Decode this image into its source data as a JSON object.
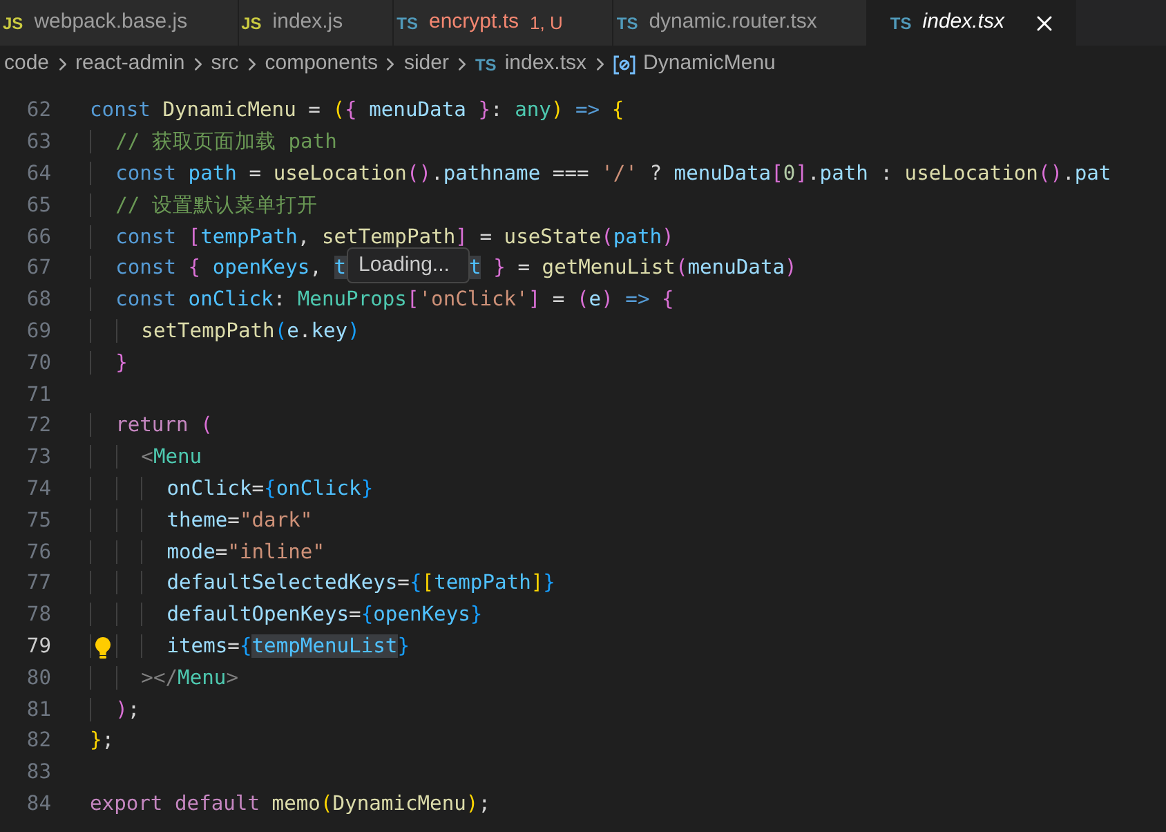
{
  "tabs": [
    {
      "icon": "JS",
      "kind": "js",
      "label": "webpack.base.js",
      "error": false,
      "selected": false
    },
    {
      "icon": "JS",
      "kind": "js",
      "label": "index.js",
      "error": false,
      "selected": false
    },
    {
      "icon": "TS",
      "kind": "ts",
      "label": "encrypt.ts",
      "status": "1, U",
      "error": true,
      "selected": false
    },
    {
      "icon": "TS",
      "kind": "ts",
      "label": "dynamic.router.tsx",
      "error": false,
      "selected": false
    },
    {
      "icon": "TS",
      "kind": "ts",
      "label": "index.tsx",
      "error": false,
      "selected": true
    }
  ],
  "breadcrumb": [
    {
      "label": "code",
      "kind": "folder"
    },
    {
      "label": "react-admin",
      "kind": "folder"
    },
    {
      "label": "src",
      "kind": "folder"
    },
    {
      "label": "components",
      "kind": "folder"
    },
    {
      "label": "sider",
      "kind": "folder"
    },
    {
      "label": "index.tsx",
      "kind": "file",
      "icon": "TS"
    },
    {
      "label": "DynamicMenu",
      "kind": "symbol"
    }
  ],
  "editor": {
    "lines": [
      {
        "number": "62",
        "tokens": [
          {
            "text": "const ",
            "kind": "kw"
          },
          {
            "text": "DynamicMenu",
            "kind": "fn"
          },
          {
            "text": " = ",
            "kind": "p"
          },
          {
            "text": "(",
            "kind": "b1"
          },
          {
            "text": "{",
            "kind": "b2"
          },
          {
            "text": " menuData ",
            "kind": "var"
          },
          {
            "text": "}",
            "kind": "b2"
          },
          {
            "text": ": ",
            "kind": "p"
          },
          {
            "text": "any",
            "kind": "type"
          },
          {
            "text": ") ",
            "kind": "b1"
          },
          {
            "text": "=> ",
            "kind": "kw"
          },
          {
            "text": "{",
            "kind": "b1"
          }
        ]
      },
      {
        "number": "63",
        "tokens": [
          {
            "text": "  // 获取页面加载 path",
            "kind": "cmt"
          }
        ]
      },
      {
        "number": "64",
        "tokens": [
          {
            "text": "  const ",
            "kind": "kw"
          },
          {
            "text": "path",
            "kind": "cst"
          },
          {
            "text": " = ",
            "kind": "p"
          },
          {
            "text": "useLocation",
            "kind": "fn"
          },
          {
            "text": "()",
            "kind": "b2"
          },
          {
            "text": ".",
            "kind": "p"
          },
          {
            "text": "pathname",
            "kind": "var"
          },
          {
            "text": " === ",
            "kind": "p"
          },
          {
            "text": "'/'",
            "kind": "str"
          },
          {
            "text": " ? ",
            "kind": "p"
          },
          {
            "text": "menuData",
            "kind": "var"
          },
          {
            "text": "[",
            "kind": "b2"
          },
          {
            "text": "0",
            "kind": "num"
          },
          {
            "text": "]",
            "kind": "b2"
          },
          {
            "text": ".",
            "kind": "p"
          },
          {
            "text": "path",
            "kind": "var"
          },
          {
            "text": " : ",
            "kind": "p"
          },
          {
            "text": "useLocation",
            "kind": "fn"
          },
          {
            "text": "()",
            "kind": "b2"
          },
          {
            "text": ".",
            "kind": "p"
          },
          {
            "text": "pat",
            "kind": "var"
          }
        ]
      },
      {
        "number": "65",
        "tokens": [
          {
            "text": "  // 设置默认菜单打开",
            "kind": "cmt"
          }
        ]
      },
      {
        "number": "66",
        "tokens": [
          {
            "text": "  const ",
            "kind": "kw"
          },
          {
            "text": "[",
            "kind": "b2"
          },
          {
            "text": "tempPath",
            "kind": "cst"
          },
          {
            "text": ", ",
            "kind": "p"
          },
          {
            "text": "setTempPath",
            "kind": "fn"
          },
          {
            "text": "]",
            "kind": "b2"
          },
          {
            "text": " = ",
            "kind": "p"
          },
          {
            "text": "useState",
            "kind": "fn"
          },
          {
            "text": "(",
            "kind": "b2"
          },
          {
            "text": "path",
            "kind": "cst"
          },
          {
            "text": ")",
            "kind": "b2"
          }
        ]
      },
      {
        "number": "67",
        "tokens": [
          {
            "text": "  const ",
            "kind": "kw"
          },
          {
            "text": "{",
            "kind": "b2"
          },
          {
            "text": " openKeys",
            "kind": "cst"
          },
          {
            "text": ", ",
            "kind": "p"
          },
          {
            "text": "t",
            "kind": "cst",
            "highlighted": true
          },
          {
            "text": "Loading...",
            "kind": "tooltip"
          },
          {
            "text": "t",
            "kind": "cst",
            "highlighted": true
          },
          {
            "text": " }",
            "kind": "b2"
          },
          {
            "text": " = ",
            "kind": "p"
          },
          {
            "text": "getMenuList",
            "kind": "fn"
          },
          {
            "text": "(",
            "kind": "b2"
          },
          {
            "text": "menuData",
            "kind": "var"
          },
          {
            "text": ")",
            "kind": "b2"
          }
        ]
      },
      {
        "number": "68",
        "tokens": [
          {
            "text": "  const ",
            "kind": "kw"
          },
          {
            "text": "onClick",
            "kind": "cst"
          },
          {
            "text": ": ",
            "kind": "p"
          },
          {
            "text": "MenuProps",
            "kind": "type"
          },
          {
            "text": "[",
            "kind": "b2"
          },
          {
            "text": "'onClick'",
            "kind": "str"
          },
          {
            "text": "]",
            "kind": "b2"
          },
          {
            "text": " = ",
            "kind": "p"
          },
          {
            "text": "(",
            "kind": "b2"
          },
          {
            "text": "e",
            "kind": "var"
          },
          {
            "text": ")",
            "kind": "b2"
          },
          {
            "text": " => ",
            "kind": "kw"
          },
          {
            "text": "{",
            "kind": "b2"
          }
        ]
      },
      {
        "number": "69",
        "tokens": [
          {
            "text": "    setTempPath",
            "kind": "fn"
          },
          {
            "text": "(",
            "kind": "b3"
          },
          {
            "text": "e",
            "kind": "var"
          },
          {
            "text": ".",
            "kind": "p"
          },
          {
            "text": "key",
            "kind": "var"
          },
          {
            "text": ")",
            "kind": "b3"
          }
        ]
      },
      {
        "number": "70",
        "tokens": [
          {
            "text": "  }",
            "kind": "b2"
          }
        ]
      },
      {
        "number": "71"
      },
      {
        "number": "72",
        "tokens": [
          {
            "text": "  return ",
            "kind": "ctl"
          },
          {
            "text": "(",
            "kind": "b2"
          }
        ]
      },
      {
        "number": "73",
        "tokens": [
          {
            "text": "    <",
            "kind": "ang"
          },
          {
            "text": "Menu",
            "kind": "type"
          }
        ]
      },
      {
        "number": "74",
        "tokens": [
          {
            "text": "      onClick",
            "kind": "var"
          },
          {
            "text": "=",
            "kind": "p"
          },
          {
            "text": "{",
            "kind": "b3"
          },
          {
            "text": "onClick",
            "kind": "cst"
          },
          {
            "text": "}",
            "kind": "b3"
          }
        ]
      },
      {
        "number": "75",
        "tokens": [
          {
            "text": "      theme",
            "kind": "var"
          },
          {
            "text": "=",
            "kind": "p"
          },
          {
            "text": "\"dark\"",
            "kind": "str"
          }
        ]
      },
      {
        "number": "76",
        "tokens": [
          {
            "text": "      mode",
            "kind": "var"
          },
          {
            "text": "=",
            "kind": "p"
          },
          {
            "text": "\"inline\"",
            "kind": "str"
          }
        ]
      },
      {
        "number": "77",
        "tokens": [
          {
            "text": "      defaultSelectedKeys",
            "kind": "var"
          },
          {
            "text": "=",
            "kind": "p"
          },
          {
            "text": "{",
            "kind": "b3"
          },
          {
            "text": "[",
            "kind": "b1"
          },
          {
            "text": "tempPath",
            "kind": "cst"
          },
          {
            "text": "]",
            "kind": "b1"
          },
          {
            "text": "}",
            "kind": "b3"
          }
        ]
      },
      {
        "number": "78",
        "tokens": [
          {
            "text": "      defaultOpenKeys",
            "kind": "var"
          },
          {
            "text": "=",
            "kind": "p"
          },
          {
            "text": "{",
            "kind": "b3"
          },
          {
            "text": "openKeys",
            "kind": "cst"
          },
          {
            "text": "}",
            "kind": "b3"
          }
        ]
      },
      {
        "number": "79",
        "current": true,
        "lightbulb": true,
        "tokens": [
          {
            "text": "      items",
            "kind": "var"
          },
          {
            "text": "=",
            "kind": "p"
          },
          {
            "text": "{",
            "kind": "b3"
          },
          {
            "text": "tempMenuList",
            "kind": "cst",
            "highlighted": true
          },
          {
            "text": "}",
            "kind": "b3"
          }
        ]
      },
      {
        "number": "80",
        "tokens": [
          {
            "text": "    >",
            "kind": "ang"
          },
          {
            "text": "</",
            "kind": "ang"
          },
          {
            "text": "Menu",
            "kind": "type"
          },
          {
            "text": ">",
            "kind": "ang"
          }
        ]
      },
      {
        "number": "81",
        "tokens": [
          {
            "text": "  )",
            "kind": "b2"
          },
          {
            "text": ";",
            "kind": "p"
          }
        ]
      },
      {
        "number": "82",
        "tokens": [
          {
            "text": "}",
            "kind": "b1"
          },
          {
            "text": ";",
            "kind": "p"
          }
        ]
      },
      {
        "number": "83"
      },
      {
        "number": "84",
        "tokens": [
          {
            "text": "export default ",
            "kind": "ctl"
          },
          {
            "text": "memo",
            "kind": "fn"
          },
          {
            "text": "(",
            "kind": "b1"
          },
          {
            "text": "DynamicMenu",
            "kind": "fn"
          },
          {
            "text": ")",
            "kind": "b1"
          },
          {
            "text": ";",
            "kind": "p"
          }
        ]
      }
    ]
  }
}
